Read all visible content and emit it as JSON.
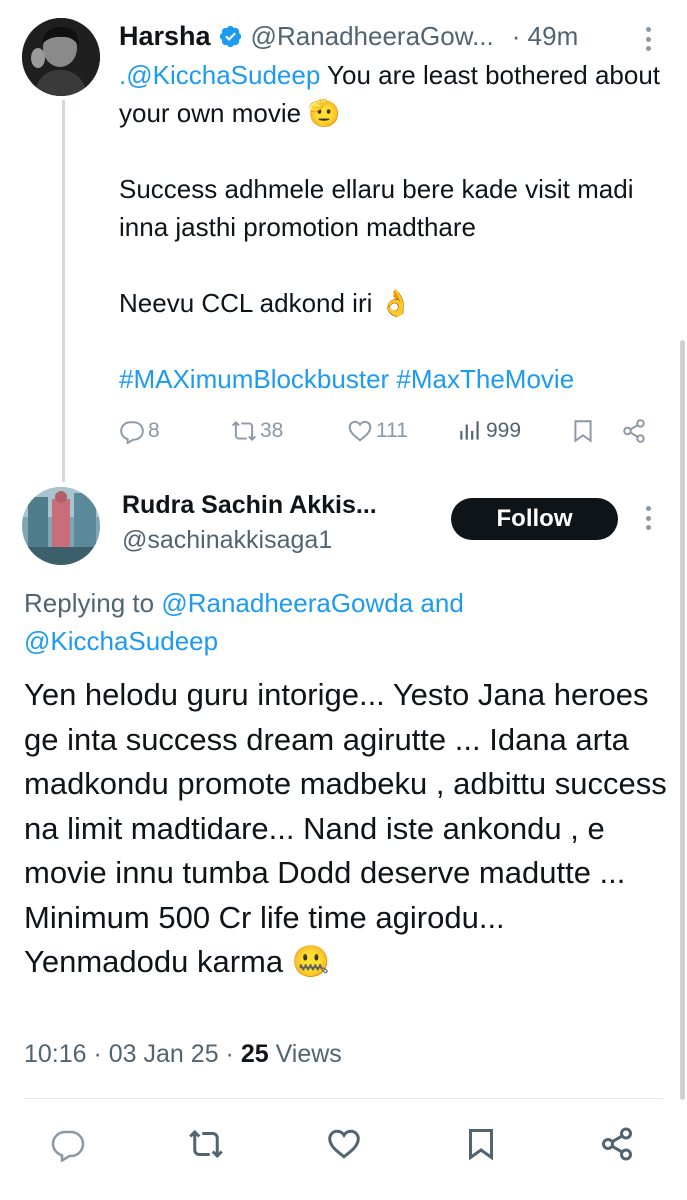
{
  "tweet1": {
    "name": "Harsha",
    "handle": "@RanadheeraGow...",
    "time": "· 49m",
    "body": {
      "mention": ".@KicchaSudeep",
      "line1_rest": " You are least bothered about your own movie 🫡",
      "line2": "Success adhmele ellaru bere kade visit madi inna jasthi promotion madthare",
      "line3": "Neevu CCL adkond iri 👌",
      "hashtags": "#MAXimumBlockbuster #MaxTheMovie"
    },
    "stats": {
      "replies": "8",
      "retweets": "38",
      "likes": "111",
      "views": "999"
    }
  },
  "tweet2": {
    "name": "Rudra Sachin Akkis...",
    "handle": "@sachinakkisaga1",
    "follow_label": "Follow",
    "replying_prefix": "Replying to ",
    "replying_to_1": "@RanadheeraGowda",
    "replying_and": " and",
    "replying_to_2": "@KicchaSudeep",
    "body": "Yen helodu guru intorige... Yesto Jana heroes ge inta success dream agirutte ... Idana arta madkondu promote madbeku , adbittu success na limit madtidare... Nand iste ankondu , e movie innu tumba Dodd deserve madutte ... Minimum 500 Cr life time agirodu... Yenmadodu karma 🤐",
    "timestamp": "10:16 · 03 Jan 25 · ",
    "views_count": "25",
    "views_label": " Views"
  },
  "icons": {
    "reply": "reply-icon",
    "retweet": "retweet-icon",
    "like": "heart-icon",
    "views": "views-icon",
    "bookmark": "bookmark-icon",
    "share": "share-icon",
    "more": "more-icon",
    "verified": "verified-badge-icon"
  },
  "colors": {
    "accent": "#1d9bf0",
    "text": "#0f1419",
    "muted": "#536471",
    "icon": "#8b98a5",
    "verified": "#1d9bf0"
  }
}
